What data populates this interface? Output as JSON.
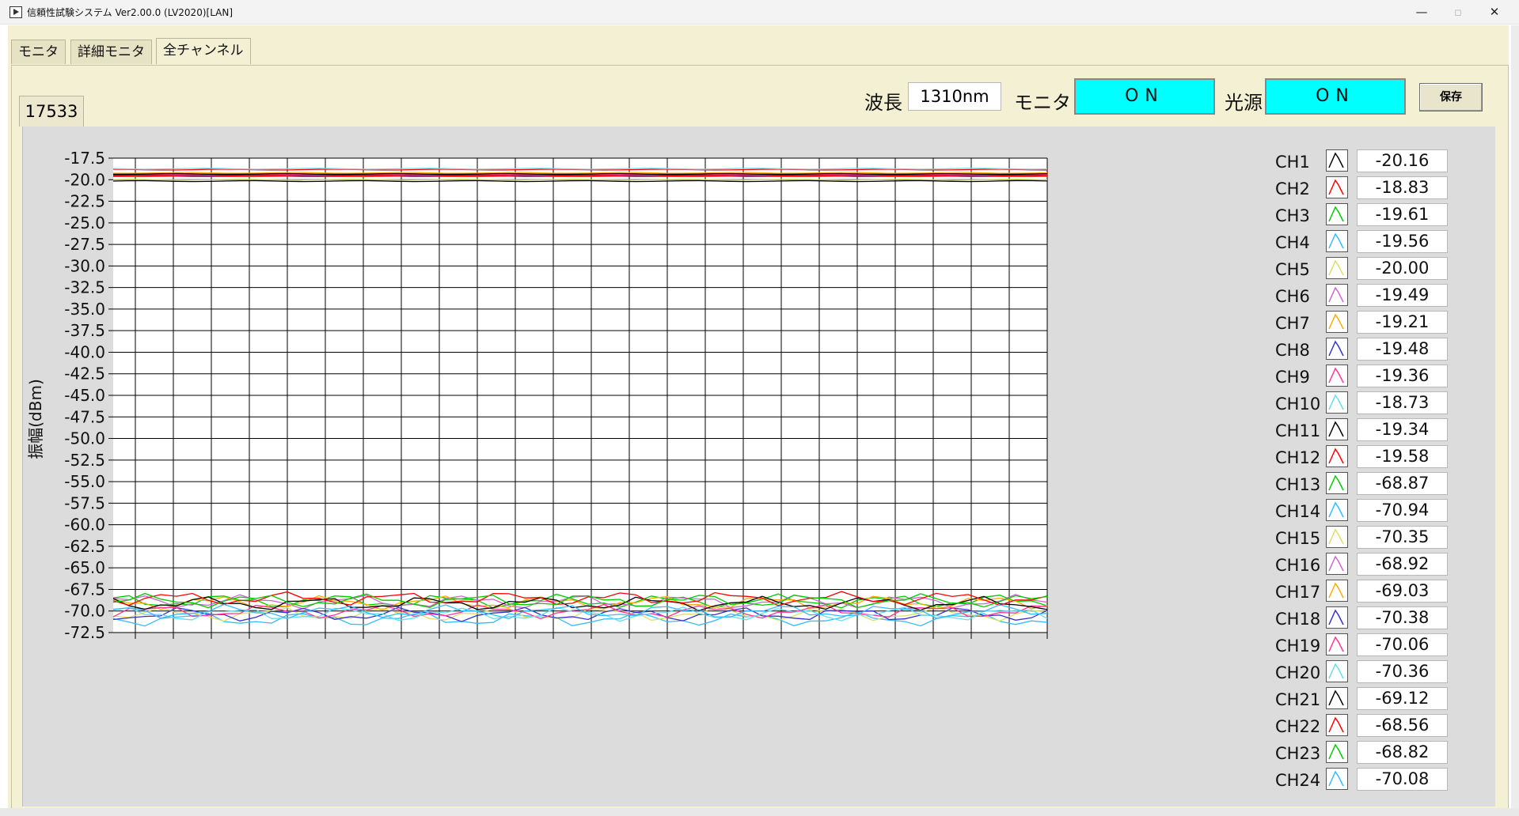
{
  "window": {
    "title": "信頼性試験システム Ver2.00.0  (LV2020)[LAN]",
    "minimize": "—",
    "maximize": "▫",
    "close": "✕"
  },
  "tabs": [
    {
      "label": "モニタ",
      "active": false
    },
    {
      "label": "詳細モニタ",
      "active": false
    },
    {
      "label": "全チャンネル",
      "active": true
    }
  ],
  "subtab": {
    "label": "17533"
  },
  "controls": {
    "wavelength_label": "波長",
    "wavelength_value": "1310nm",
    "monitor_label": "モニタ",
    "monitor_state": "ON",
    "light_label": "光源",
    "light_state": "ON",
    "save_label": "保存",
    "on_color": "#00ffff"
  },
  "chart_data": {
    "type": "line",
    "ylabel": "振幅(dBm)",
    "ylim": [
      -72.5,
      -17.5
    ],
    "yticks": [
      "-17.5",
      "-20.0",
      "-22.5",
      "-25.0",
      "-27.5",
      "-30.0",
      "-32.5",
      "-35.0",
      "-37.5",
      "-40.0",
      "-42.5",
      "-45.0",
      "-47.5",
      "-50.0",
      "-52.5",
      "-55.0",
      "-57.5",
      "-60.0",
      "-62.5",
      "-65.0",
      "-67.5",
      "-70.0",
      "-72.5"
    ],
    "grid": true,
    "x_points": 60,
    "series": [
      {
        "name": "CH1",
        "color": "#000000",
        "value": -20.16
      },
      {
        "name": "CH2",
        "color": "#ff0000",
        "value": -18.83
      },
      {
        "name": "CH3",
        "color": "#00cc00",
        "value": -19.61
      },
      {
        "name": "CH4",
        "color": "#33bbff",
        "value": -19.56
      },
      {
        "name": "CH5",
        "color": "#dddd66",
        "value": -20.0
      },
      {
        "name": "CH6",
        "color": "#cc66cc",
        "value": -19.49
      },
      {
        "name": "CH7",
        "color": "#ffaa00",
        "value": -19.21
      },
      {
        "name": "CH8",
        "color": "#3333cc",
        "value": -19.48
      },
      {
        "name": "CH9",
        "color": "#ff3399",
        "value": -19.36
      },
      {
        "name": "CH10",
        "color": "#66ddee",
        "value": -18.73
      },
      {
        "name": "CH11",
        "color": "#000000",
        "value": -19.34
      },
      {
        "name": "CH12",
        "color": "#ff0000",
        "value": -19.58
      },
      {
        "name": "CH13",
        "color": "#00cc00",
        "value": -68.87
      },
      {
        "name": "CH14",
        "color": "#33bbff",
        "value": -70.94
      },
      {
        "name": "CH15",
        "color": "#dddd66",
        "value": -70.35
      },
      {
        "name": "CH16",
        "color": "#cc66cc",
        "value": -68.92
      },
      {
        "name": "CH17",
        "color": "#ffaa00",
        "value": -69.03
      },
      {
        "name": "CH18",
        "color": "#3333cc",
        "value": -70.38
      },
      {
        "name": "CH19",
        "color": "#ff3399",
        "value": -70.06
      },
      {
        "name": "CH20",
        "color": "#66ddee",
        "value": -70.36
      },
      {
        "name": "CH21",
        "color": "#000000",
        "value": -69.12
      },
      {
        "name": "CH22",
        "color": "#ff0000",
        "value": -68.56
      },
      {
        "name": "CH23",
        "color": "#00cc00",
        "value": -68.82
      },
      {
        "name": "CH24",
        "color": "#33bbff",
        "value": -70.08
      }
    ]
  },
  "channels": [
    {
      "label": "CH1",
      "value": "-20.16",
      "color": "#000000"
    },
    {
      "label": "CH2",
      "value": "-18.83",
      "color": "#ff0000"
    },
    {
      "label": "CH3",
      "value": "-19.61",
      "color": "#00cc00"
    },
    {
      "label": "CH4",
      "value": "-19.56",
      "color": "#33bbff"
    },
    {
      "label": "CH5",
      "value": "-20.00",
      "color": "#dddd66"
    },
    {
      "label": "CH6",
      "value": "-19.49",
      "color": "#cc66cc"
    },
    {
      "label": "CH7",
      "value": "-19.21",
      "color": "#ffaa00"
    },
    {
      "label": "CH8",
      "value": "-19.48",
      "color": "#3333cc"
    },
    {
      "label": "CH9",
      "value": "-19.36",
      "color": "#ff3399"
    },
    {
      "label": "CH10",
      "value": "-18.73",
      "color": "#66ddee"
    },
    {
      "label": "CH11",
      "value": "-19.34",
      "color": "#000000"
    },
    {
      "label": "CH12",
      "value": "-19.58",
      "color": "#ff0000"
    },
    {
      "label": "CH13",
      "value": "-68.87",
      "color": "#00cc00"
    },
    {
      "label": "CH14",
      "value": "-70.94",
      "color": "#33bbff"
    },
    {
      "label": "CH15",
      "value": "-70.35",
      "color": "#dddd66"
    },
    {
      "label": "CH16",
      "value": "-68.92",
      "color": "#cc66cc"
    },
    {
      "label": "CH17",
      "value": "-69.03",
      "color": "#ffaa00"
    },
    {
      "label": "CH18",
      "value": "-70.38",
      "color": "#3333cc"
    },
    {
      "label": "CH19",
      "value": "-70.06",
      "color": "#ff3399"
    },
    {
      "label": "CH20",
      "value": "-70.36",
      "color": "#66ddee"
    },
    {
      "label": "CH21",
      "value": "-69.12",
      "color": "#000000"
    },
    {
      "label": "CH22",
      "value": "-68.56",
      "color": "#ff0000"
    },
    {
      "label": "CH23",
      "value": "-68.82",
      "color": "#00cc00"
    },
    {
      "label": "CH24",
      "value": "-70.08",
      "color": "#33bbff"
    }
  ]
}
